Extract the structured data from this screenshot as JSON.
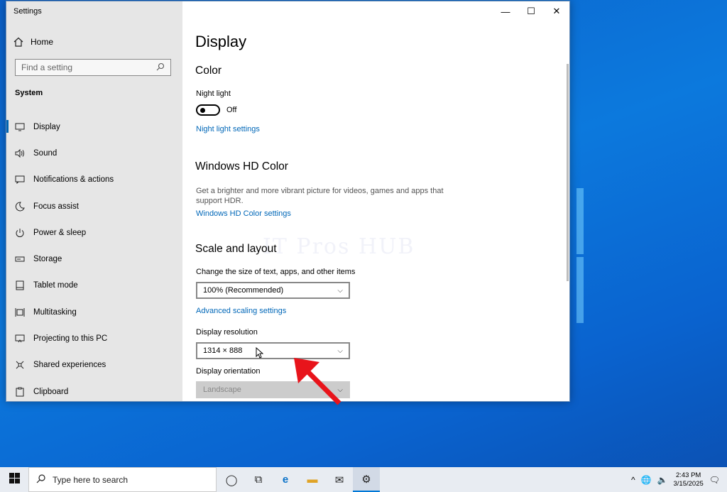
{
  "window": {
    "title": "Settings",
    "minimize_icon": "minimize-icon",
    "maximize_icon": "maximize-icon",
    "close_icon": "close-icon"
  },
  "sidebar": {
    "home_label": "Home",
    "search_placeholder": "Find a setting",
    "section_label": "System",
    "items": [
      {
        "label": "Display",
        "icon": "monitor-icon",
        "active": true
      },
      {
        "label": "Sound",
        "icon": "speaker-icon"
      },
      {
        "label": "Notifications & actions",
        "icon": "notification-icon"
      },
      {
        "label": "Focus assist",
        "icon": "moon-icon"
      },
      {
        "label": "Power & sleep",
        "icon": "power-icon"
      },
      {
        "label": "Storage",
        "icon": "storage-icon"
      },
      {
        "label": "Tablet mode",
        "icon": "tablet-icon"
      },
      {
        "label": "Multitasking",
        "icon": "multitasking-icon"
      },
      {
        "label": "Projecting to this PC",
        "icon": "projecting-icon"
      },
      {
        "label": "Shared experiences",
        "icon": "share-icon"
      },
      {
        "label": "Clipboard",
        "icon": "clipboard-icon"
      }
    ]
  },
  "content": {
    "page_title": "Display",
    "color_heading": "Color",
    "night_light_label": "Night light",
    "night_light_state": "Off",
    "night_light_link": "Night light settings",
    "hd_color_heading": "Windows HD Color",
    "hd_color_desc": "Get a brighter and more vibrant picture for videos, games and apps that support HDR.",
    "hd_color_link": "Windows HD Color settings",
    "scale_heading": "Scale and layout",
    "scale_label": "Change the size of text, apps, and other items",
    "scale_value": "100% (Recommended)",
    "advanced_scaling_link": "Advanced scaling settings",
    "resolution_label": "Display resolution",
    "resolution_value": "1314 × 888",
    "orientation_label": "Display orientation",
    "orientation_value": "Landscape",
    "watermark": "IT Pros HUB"
  },
  "taskbar": {
    "search_placeholder": "Type here to search",
    "time": "2:43 PM",
    "date": "3/15/2025"
  },
  "colors": {
    "accent": "#0063b1",
    "link": "#0067b8",
    "arrow": "#e8141b"
  }
}
